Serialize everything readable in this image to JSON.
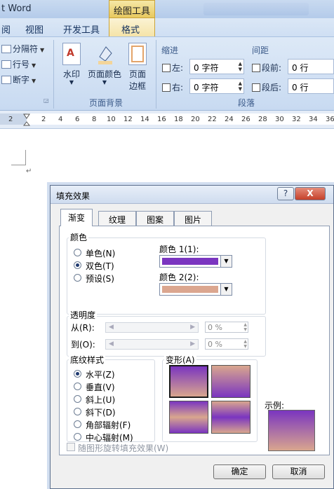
{
  "app": {
    "title_fragment": "t Word",
    "context_tab": "绘图工具"
  },
  "ribbon_tabs": [
    "阅",
    "视图",
    "开发工具",
    "格式"
  ],
  "ribbon": {
    "page_setup_items": [
      {
        "label": "分隔符",
        "icon": "page-break-icon"
      },
      {
        "label": "行号",
        "icon": "line-numbers-icon"
      },
      {
        "label": "断字",
        "icon": "hyphenation-icon"
      }
    ],
    "page_background": {
      "watermark": "水印",
      "page_color": "页面颜色",
      "page_borders_line1": "页面",
      "page_borders_line2": "边框",
      "group_label": "页面背景"
    },
    "paragraph": {
      "indent_label": "缩进",
      "spacing_label": "间距",
      "left_label": "左:",
      "right_label": "右:",
      "before_label": "段前:",
      "after_label": "段后:",
      "left_value": "0 字符",
      "right_value": "0 字符",
      "before_value": "0 行",
      "after_value": "0 行",
      "group_label": "段落"
    }
  },
  "ruler_marks": [
    "2",
    "2",
    "4",
    "6",
    "8",
    "10",
    "12",
    "14",
    "16",
    "18",
    "20",
    "22",
    "24",
    "26",
    "28",
    "30",
    "32",
    "34",
    "36"
  ],
  "dialog": {
    "title": "填充效果",
    "help": "?",
    "close": "X",
    "tabs": [
      "渐变",
      "纹理",
      "图案",
      "图片"
    ],
    "colors_group": "颜色",
    "color_options": [
      "单色(N)",
      "双色(T)",
      "预设(S)"
    ],
    "color_selected": "双色(T)",
    "color1_label": "颜色 1(1):",
    "color2_label": "颜色 2(2):",
    "color1": "#7a35c0",
    "color2": "#dba68f",
    "transparency_group": "透明度",
    "from_label": "从(R):",
    "to_label": "到(O):",
    "from_value": "0 %",
    "to_value": "0 %",
    "shading_group": "底纹样式",
    "shading_options": [
      "水平(Z)",
      "垂直(V)",
      "斜上(U)",
      "斜下(D)",
      "角部辐射(F)",
      "中心辐射(M)"
    ],
    "shading_selected": "水平(Z)",
    "variants_group": "变形(A)",
    "sample_label": "示例:",
    "rotate_checkbox": "随图形旋转填充效果(W)",
    "ok": "确定",
    "cancel": "取消"
  }
}
